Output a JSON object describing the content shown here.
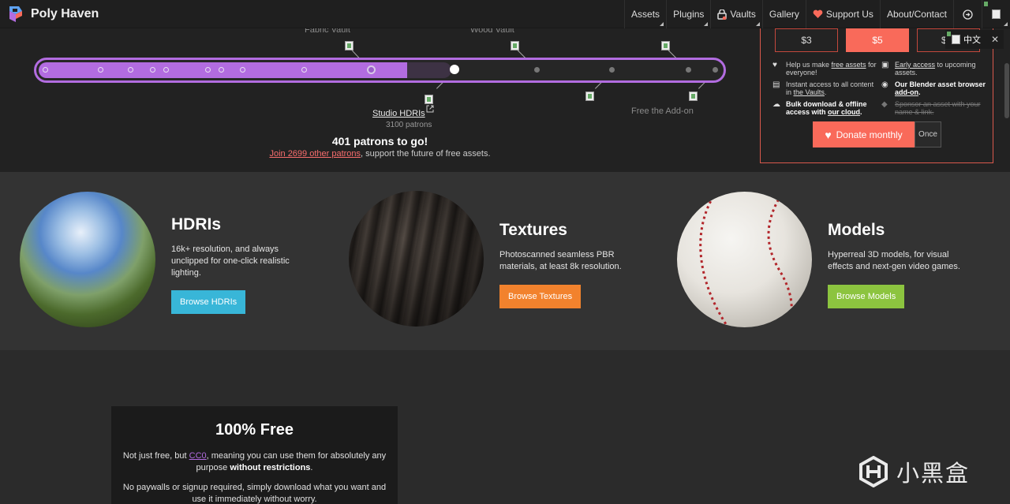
{
  "nav": {
    "logo_text": "Poly Haven",
    "items": [
      {
        "label": "Assets",
        "caret": true
      },
      {
        "label": "Plugins",
        "caret": true
      },
      {
        "label": "Vaults",
        "caret": true
      },
      {
        "label": "Gallery",
        "caret": false
      },
      {
        "label": "Support Us",
        "caret": false
      },
      {
        "label": "About/Contact",
        "caret": false
      }
    ],
    "icons": [
      "lock-icon",
      "heart-icon",
      "login-icon",
      "broken-image-icon"
    ]
  },
  "progress": {
    "top_milestones": [
      "Fabric Vault",
      "Wood Vault"
    ],
    "studio_label": "Studio HDRIs",
    "studio_patrons": "3100 patrons",
    "free_addon": "Free the Add-on",
    "to_go": "401 patrons to go!",
    "join_link": "Join 2699 other patrons",
    "join_rest": ", support the future of free assets.",
    "fill_fraction": 0.54,
    "goal_fraction": 0.605
  },
  "donate": {
    "amounts": [
      "$3",
      "$5",
      "$"
    ],
    "selected_amount": "$5",
    "lang": "中文",
    "perks": {
      "p1a": "Help us make ",
      "p1link": "free assets",
      "p1b": " for everyone!",
      "p2a": "Early access",
      "p2b": " to upcoming assets.",
      "p3a": "Instant access to all content in ",
      "p3link": "the Vaults",
      "p3b": ".",
      "p4a": "Our Blender asset browser ",
      "p4link": "add-on",
      "p4b": ".",
      "p5a": "Bulk download & offline access with ",
      "p5link": "our cloud",
      "p5b": ".",
      "p6": "Sponsor an asset with your name & link."
    },
    "donate_label": "Donate monthly",
    "once_label": "Once"
  },
  "cards": [
    {
      "title": "HDRIs",
      "desc": "16k+ resolution, and always unclipped for one-click realistic lighting.",
      "button": "Browse HDRIs",
      "color": "#38b6d8"
    },
    {
      "title": "Textures",
      "desc": "Photoscanned seamless PBR materials, at least 8k resolution.",
      "button": "Browse Textures",
      "color": "#f2822d"
    },
    {
      "title": "Models",
      "desc": "Hyperreal 3D models, for visual effects and next-gen video games.",
      "button": "Browse Models",
      "color": "#8cc43f"
    }
  ],
  "free": {
    "title": "100% Free",
    "p1a": "Not just free, but ",
    "p1link": "CC0",
    "p1b": ", meaning you can use them for absolutely any purpose ",
    "p1bold": "without restrictions",
    "p1c": ".",
    "p2": "No paywalls or signup required, simply download what you want and use it immediately without worry."
  },
  "watermark": "小黑盒",
  "colors": {
    "accent_purple": "#b26ce0",
    "donate_red": "#f96a5a"
  }
}
